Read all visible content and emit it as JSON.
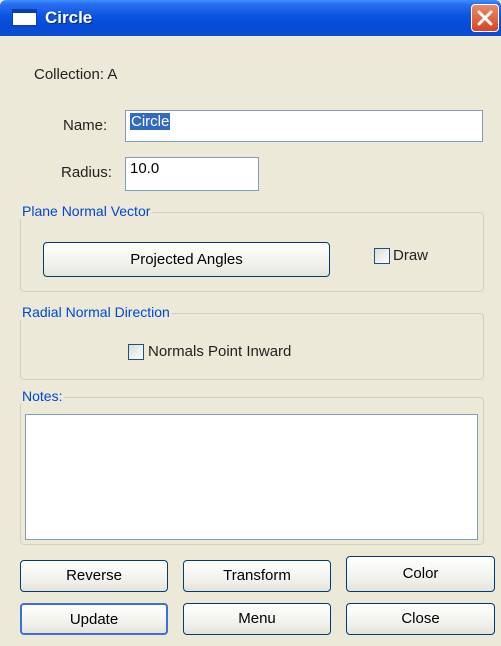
{
  "window": {
    "title": "Circle"
  },
  "collection": {
    "label": "Collection:",
    "value": "A"
  },
  "name": {
    "label": "Name:",
    "value": "Circle"
  },
  "radius": {
    "label": "Radius:",
    "value": "10.0"
  },
  "plane_normal": {
    "legend": "Plane Normal Vector",
    "projected_button": "Projected Angles",
    "draw_label": "Draw",
    "draw_checked": false
  },
  "radial_normal": {
    "legend": "Radial Normal Direction",
    "inward_label": "Normals Point Inward",
    "inward_checked": false
  },
  "notes": {
    "legend": "Notes:",
    "value": ""
  },
  "buttons": {
    "reverse": "Reverse",
    "transform": "Transform",
    "color": "Color",
    "update": "Update",
    "menu": "Menu",
    "close": "Close"
  }
}
